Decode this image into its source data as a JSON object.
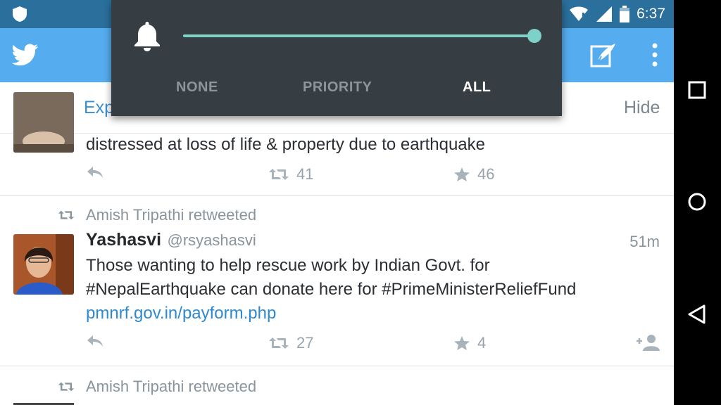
{
  "status_bar": {
    "time": "6:37"
  },
  "volume_popup": {
    "level_fraction": 1.0,
    "modes": [
      "NONE",
      "PRIORITY",
      "ALL"
    ],
    "selected_mode": "ALL"
  },
  "banner": {
    "text": "Exp",
    "hide_label": "Hide"
  },
  "tweets": [
    {
      "text": "distressed at loss of life & property due to earthquake",
      "retweets": "41",
      "favorites": "46"
    },
    {
      "retweeted_by": "Amish Tripathi retweeted",
      "author": "Yashasvi",
      "handle": "@rsyashasvi",
      "time": "51m",
      "line1": "Those wanting to help rescue work by Indian Govt. for",
      "line2": "#NepalEarthquake can donate here for #PrimeMinisterReliefFund",
      "link": "pmnrf.gov.in/payform.php",
      "retweets": "27",
      "favorites": "4"
    },
    {
      "retweeted_by": "Amish Tripathi retweeted"
    }
  ],
  "colors": {
    "status_bar": "#2b6f9c",
    "app_bar": "#55acee",
    "slider": "#7dd1c7",
    "popup": "#363e43",
    "link": "#2e8ad0"
  }
}
